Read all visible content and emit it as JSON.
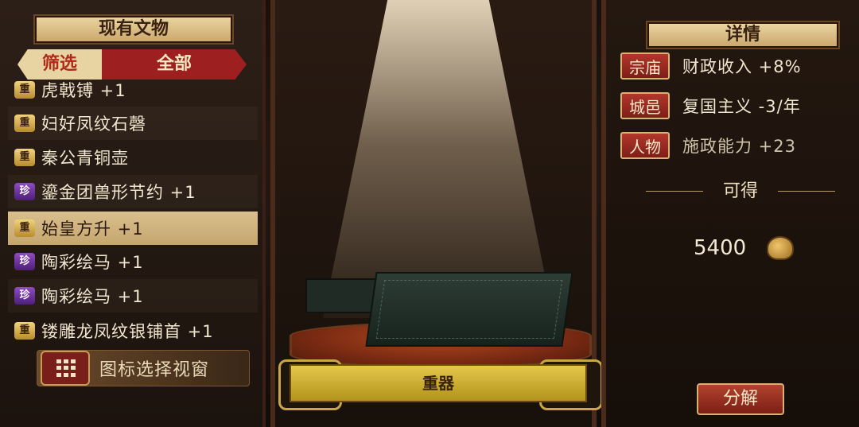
{
  "left_panel": {
    "title": "现有文物",
    "filter": {
      "label": "筛选",
      "value": "全部"
    },
    "items": [
      {
        "badge": "重",
        "type": "zhong",
        "name": "虎戟镈 +1"
      },
      {
        "badge": "重",
        "type": "zhong",
        "name": "妇好凤纹石磬"
      },
      {
        "badge": "重",
        "type": "zhong",
        "name": "秦公青铜壶"
      },
      {
        "badge": "珍",
        "type": "zhen",
        "name": "鎏金团兽形节约 +1"
      },
      {
        "badge": "重",
        "type": "zhong",
        "name": "始皇方升 +1",
        "selected": true
      },
      {
        "badge": "珍",
        "type": "zhen",
        "name": "陶彩绘马 +1"
      },
      {
        "badge": "珍",
        "type": "zhen",
        "name": "陶彩绘马 +1"
      },
      {
        "badge": "重",
        "type": "zhong",
        "name": "镂雕龙凤纹银铺首 +1"
      }
    ],
    "icon_select_label": "图标选择视窗"
  },
  "stage": {
    "category": "重器"
  },
  "right_panel": {
    "title": "详情",
    "rows": [
      {
        "tag": "宗庙",
        "value": "财政收入 +8%"
      },
      {
        "tag": "城邑",
        "value": "复国主义 -3/年"
      },
      {
        "tag": "人物",
        "value": "施政能力 +23"
      }
    ],
    "obtainable_label": "可得",
    "reward_amount": "5400",
    "decompose_label": "分解"
  }
}
